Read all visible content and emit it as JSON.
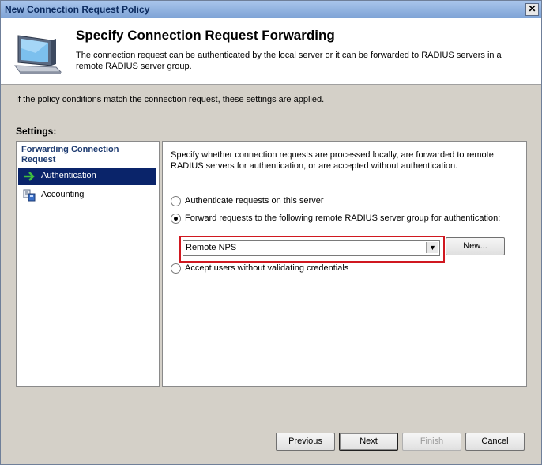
{
  "window": {
    "title": "New Connection Request Policy",
    "close_glyph": "✕"
  },
  "header": {
    "title": "Specify Connection Request Forwarding",
    "description": "The connection request can be authenticated by the local server or it can be forwarded to RADIUS servers in a remote RADIUS server group.",
    "icon": "computer-monitor-icon"
  },
  "info_text": "If the policy conditions match the connection request, these settings are applied.",
  "settings_label": "Settings:",
  "sidebar": {
    "heading": "Forwarding Connection Request",
    "items": [
      {
        "label": "Authentication",
        "icon": "green-arrow-icon",
        "selected": true
      },
      {
        "label": "Accounting",
        "icon": "accounting-icon",
        "selected": false
      }
    ]
  },
  "main": {
    "description": "Specify whether connection requests are processed locally, are forwarded to remote RADIUS servers for authentication, or are accepted without authentication.",
    "options": [
      {
        "label": "Authenticate requests on this server",
        "selected": false
      },
      {
        "label": "Forward requests to the following remote RADIUS server group for authentication:",
        "selected": true
      },
      {
        "label": "Accept users without validating credentials",
        "selected": false
      }
    ],
    "server_group": {
      "value": "Remote NPS",
      "arrow": "▼"
    },
    "new_button": "New..."
  },
  "footer": {
    "previous": "Previous",
    "next": "Next",
    "finish": "Finish",
    "cancel": "Cancel"
  },
  "colors": {
    "selection": "#0a246a",
    "highlight_border": "#d01820"
  }
}
